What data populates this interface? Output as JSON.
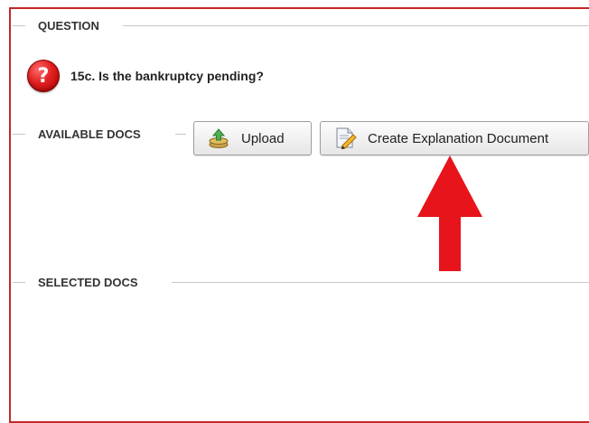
{
  "question_section": {
    "legend": "QUESTION",
    "question_text": "15c. Is the bankruptcy pending?",
    "question_icon": "question-mark-icon",
    "question_icon_glyph": "?"
  },
  "available_docs": {
    "legend": "AVAILABLE DOCS",
    "upload_button": {
      "label": "Upload",
      "icon": "upload-icon"
    },
    "explanation_button": {
      "label": "Create Explanation Document",
      "icon": "document-edit-icon"
    }
  },
  "selected_docs": {
    "legend": "SELECTED DOCS"
  },
  "annotation": {
    "icon": "red-arrow-up-icon",
    "color": "#e8141c"
  },
  "colors": {
    "frame_border": "#c62828",
    "accent_red": "#e02020"
  }
}
